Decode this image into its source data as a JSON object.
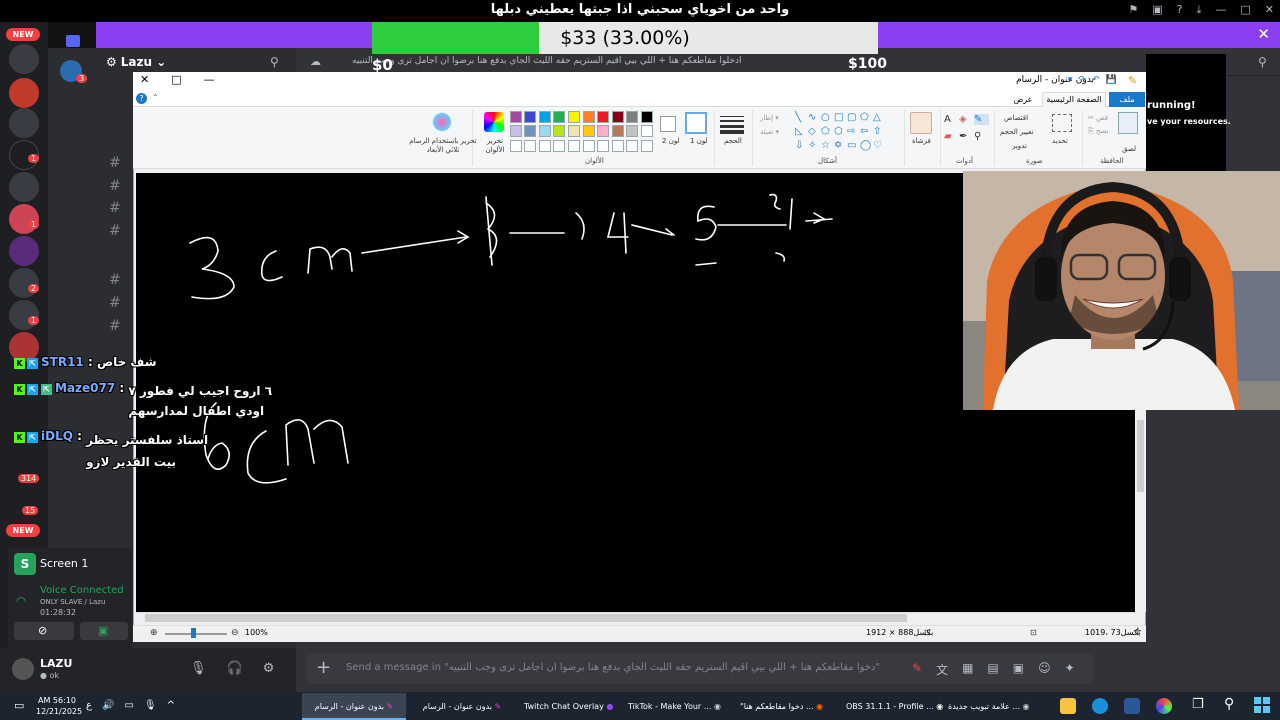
{
  "banner": {
    "title": "واحد من اخوياي سحبني اذا جبتها يعطيني دبلها"
  },
  "goal": {
    "label": "$33 (33.00%)",
    "progress_percent": 33,
    "min": "$0",
    "max": "$100",
    "min_visible": "$0",
    "green": "#2ecc3f",
    "grey": "#e8e8e8",
    "bar_color": "#8c3ff0"
  },
  "discord": {
    "server_name": "Lazu",
    "new_label": "NEW",
    "channel_header": "ادخلوا مقاطعكم هنا + اللي بيي اقيم الستريم حقه الليث الجاي بدفع هنا برضوا ان اجامل ترى وجب التنبيه",
    "voice": {
      "screen_label": "Screen 1",
      "status": "Voice Connected",
      "channel": "ONLY SLAVE / Lazu",
      "elapsed": "01:28:32"
    },
    "user": {
      "name": "LAZU",
      "status": "ok"
    },
    "message_placeholder": "Send a message in \"دخوا مقاطعكم هنا + اللي بيي اقيم الستريم حقه الليث الجاي بدفع هنا برضوا ان اجامل ترى وجب التنبيه\"",
    "badges": [
      "1",
      "1",
      "2",
      "1",
      "1",
      "314",
      "15",
      "3"
    ]
  },
  "paint": {
    "title": "بدون عنوان - الرسام",
    "tabs": {
      "file": "ملف",
      "home": "الصفحة الرئيسية",
      "view": "عرض"
    },
    "groups": {
      "clipboard": "الحافظة",
      "image": "صورة",
      "tools": "أدوات",
      "shapes": "أشكال",
      "colors": "الألوان"
    },
    "clipboard": {
      "paste": "لصق",
      "cut": "قص",
      "copy": "نسخ"
    },
    "image": {
      "select": "تحديد",
      "crop": "اقتصاص",
      "resize": "تغيير الحجم",
      "rotate": "تدوير"
    },
    "brushes": "فرشاة",
    "shape_opts": {
      "outline": "إطار",
      "fill": "تعبئة"
    },
    "size": "الحجم",
    "color1": "لون 1",
    "color2": "لون 2",
    "edit_colors": "تحرير الألوان",
    "paint3d": "تحرير باستخدام الرسام ثلاثي الأبعاد",
    "status": {
      "cursor": "1019، 73بكسل",
      "canvas_size": "1912 × 888بكسل",
      "zoom": "100%"
    }
  },
  "stream": {
    "running_text": "running!",
    "resources_text": "ve your resources."
  },
  "chat_overlay": [
    {
      "user": "STR11",
      "message": "شف خاص"
    },
    {
      "user": "Maze077",
      "message": "٦ اروح اجيب لي فطور ٧ اودي اطفال لمدارسهم"
    },
    {
      "user": "iDLQ",
      "message": "استاذ سلفستر يحظر بيت القدير لازو"
    }
  ],
  "taskbar": {
    "time": "AM 56:10",
    "date": "12/21/2025",
    "apps": [
      {
        "label": "بدون عنوان - الرسام",
        "active": true
      },
      {
        "label": "بدون عنوان - الرسام",
        "active": false
      },
      {
        "label": "Twitch Chat Overlay",
        "active": false
      },
      {
        "label": "TikTok - Make Your ...",
        "active": false
      },
      {
        "label": "\"دخوا مقاطعكم هنا ...",
        "active": false
      },
      {
        "label": "OBS 31.1.1 - Profile ...",
        "active": false
      },
      {
        "label": "علامة تبويب جديدة ...",
        "active": false
      }
    ]
  },
  "colors": {
    "accent": "#1979ca",
    "discord_green": "#23a559",
    "discord_red": "#f23f43"
  }
}
